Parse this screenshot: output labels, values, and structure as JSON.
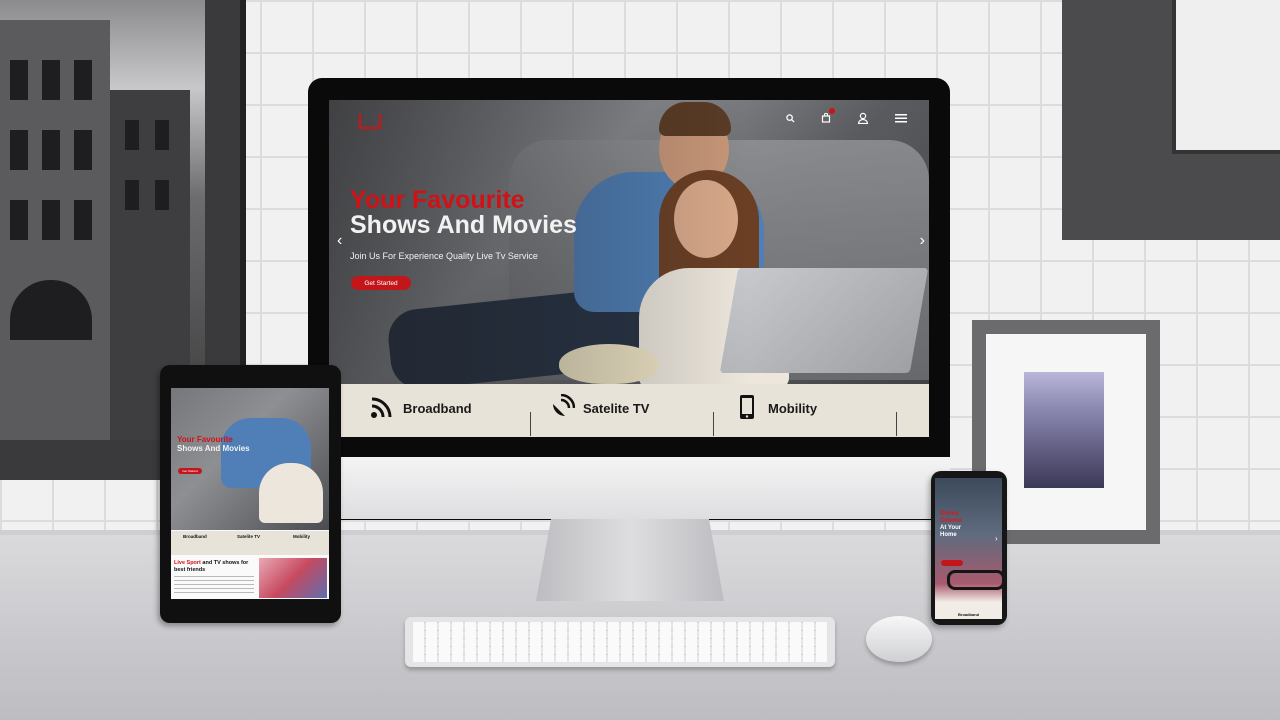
{
  "scene": {
    "devices": [
      "desktop-monitor",
      "tablet",
      "smartphone"
    ]
  },
  "desktop_site": {
    "nav_icons": [
      "search-icon",
      "cart-icon",
      "user-icon",
      "menu-icon"
    ],
    "hero": {
      "title_line1": "Your Favourite",
      "title_line2": "Shows And Movies",
      "subtitle": "Join Us  For Experience Quality Live Tv Service",
      "cta": "Get Started",
      "arrow_left": "‹",
      "arrow_right": "›"
    },
    "services": [
      {
        "label": "Broadband",
        "icon": "wifi-icon",
        "glyph": "📶"
      },
      {
        "label": "Satelite TV",
        "icon": "satellite-icon",
        "glyph": "📡"
      },
      {
        "label": "Mobility",
        "icon": "mobile-icon",
        "glyph": "📱"
      }
    ]
  },
  "tablet_site": {
    "hero": {
      "title_line1": "Your Favourite",
      "title_line2": "Shows And Movies",
      "cta": "Get Started"
    },
    "services": [
      "Broadband",
      "Satelite TV",
      "Mobility"
    ],
    "section": {
      "highlight": "Live Sport",
      "rest": " and TV shows for best friends"
    }
  },
  "phone_site": {
    "hero": {
      "title_line1": "Online",
      "title_line2": "Cinema",
      "title_line3": "At Your",
      "title_line4": "Home"
    },
    "service": "Broadband"
  },
  "colors": {
    "brand_red": "#d01217",
    "service_bar": "#e8e3d8"
  }
}
